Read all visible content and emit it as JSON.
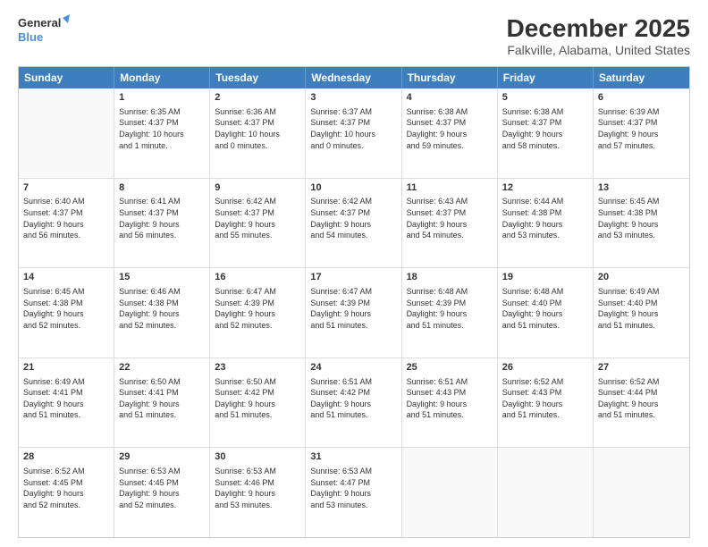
{
  "header": {
    "logo_line1": "General",
    "logo_line2": "Blue",
    "main_title": "December 2025",
    "subtitle": "Falkville, Alabama, United States"
  },
  "days_of_week": [
    "Sunday",
    "Monday",
    "Tuesday",
    "Wednesday",
    "Thursday",
    "Friday",
    "Saturday"
  ],
  "weeks": [
    [
      {
        "day": "",
        "info": ""
      },
      {
        "day": "1",
        "info": "Sunrise: 6:35 AM\nSunset: 4:37 PM\nDaylight: 10 hours\nand 1 minute."
      },
      {
        "day": "2",
        "info": "Sunrise: 6:36 AM\nSunset: 4:37 PM\nDaylight: 10 hours\nand 0 minutes."
      },
      {
        "day": "3",
        "info": "Sunrise: 6:37 AM\nSunset: 4:37 PM\nDaylight: 10 hours\nand 0 minutes."
      },
      {
        "day": "4",
        "info": "Sunrise: 6:38 AM\nSunset: 4:37 PM\nDaylight: 9 hours\nand 59 minutes."
      },
      {
        "day": "5",
        "info": "Sunrise: 6:38 AM\nSunset: 4:37 PM\nDaylight: 9 hours\nand 58 minutes."
      },
      {
        "day": "6",
        "info": "Sunrise: 6:39 AM\nSunset: 4:37 PM\nDaylight: 9 hours\nand 57 minutes."
      }
    ],
    [
      {
        "day": "7",
        "info": "Sunrise: 6:40 AM\nSunset: 4:37 PM\nDaylight: 9 hours\nand 56 minutes."
      },
      {
        "day": "8",
        "info": "Sunrise: 6:41 AM\nSunset: 4:37 PM\nDaylight: 9 hours\nand 56 minutes."
      },
      {
        "day": "9",
        "info": "Sunrise: 6:42 AM\nSunset: 4:37 PM\nDaylight: 9 hours\nand 55 minutes."
      },
      {
        "day": "10",
        "info": "Sunrise: 6:42 AM\nSunset: 4:37 PM\nDaylight: 9 hours\nand 54 minutes."
      },
      {
        "day": "11",
        "info": "Sunrise: 6:43 AM\nSunset: 4:37 PM\nDaylight: 9 hours\nand 54 minutes."
      },
      {
        "day": "12",
        "info": "Sunrise: 6:44 AM\nSunset: 4:38 PM\nDaylight: 9 hours\nand 53 minutes."
      },
      {
        "day": "13",
        "info": "Sunrise: 6:45 AM\nSunset: 4:38 PM\nDaylight: 9 hours\nand 53 minutes."
      }
    ],
    [
      {
        "day": "14",
        "info": "Sunrise: 6:45 AM\nSunset: 4:38 PM\nDaylight: 9 hours\nand 52 minutes."
      },
      {
        "day": "15",
        "info": "Sunrise: 6:46 AM\nSunset: 4:38 PM\nDaylight: 9 hours\nand 52 minutes."
      },
      {
        "day": "16",
        "info": "Sunrise: 6:47 AM\nSunset: 4:39 PM\nDaylight: 9 hours\nand 52 minutes."
      },
      {
        "day": "17",
        "info": "Sunrise: 6:47 AM\nSunset: 4:39 PM\nDaylight: 9 hours\nand 51 minutes."
      },
      {
        "day": "18",
        "info": "Sunrise: 6:48 AM\nSunset: 4:39 PM\nDaylight: 9 hours\nand 51 minutes."
      },
      {
        "day": "19",
        "info": "Sunrise: 6:48 AM\nSunset: 4:40 PM\nDaylight: 9 hours\nand 51 minutes."
      },
      {
        "day": "20",
        "info": "Sunrise: 6:49 AM\nSunset: 4:40 PM\nDaylight: 9 hours\nand 51 minutes."
      }
    ],
    [
      {
        "day": "21",
        "info": "Sunrise: 6:49 AM\nSunset: 4:41 PM\nDaylight: 9 hours\nand 51 minutes."
      },
      {
        "day": "22",
        "info": "Sunrise: 6:50 AM\nSunset: 4:41 PM\nDaylight: 9 hours\nand 51 minutes."
      },
      {
        "day": "23",
        "info": "Sunrise: 6:50 AM\nSunset: 4:42 PM\nDaylight: 9 hours\nand 51 minutes."
      },
      {
        "day": "24",
        "info": "Sunrise: 6:51 AM\nSunset: 4:42 PM\nDaylight: 9 hours\nand 51 minutes."
      },
      {
        "day": "25",
        "info": "Sunrise: 6:51 AM\nSunset: 4:43 PM\nDaylight: 9 hours\nand 51 minutes."
      },
      {
        "day": "26",
        "info": "Sunrise: 6:52 AM\nSunset: 4:43 PM\nDaylight: 9 hours\nand 51 minutes."
      },
      {
        "day": "27",
        "info": "Sunrise: 6:52 AM\nSunset: 4:44 PM\nDaylight: 9 hours\nand 51 minutes."
      }
    ],
    [
      {
        "day": "28",
        "info": "Sunrise: 6:52 AM\nSunset: 4:45 PM\nDaylight: 9 hours\nand 52 minutes."
      },
      {
        "day": "29",
        "info": "Sunrise: 6:53 AM\nSunset: 4:45 PM\nDaylight: 9 hours\nand 52 minutes."
      },
      {
        "day": "30",
        "info": "Sunrise: 6:53 AM\nSunset: 4:46 PM\nDaylight: 9 hours\nand 53 minutes."
      },
      {
        "day": "31",
        "info": "Sunrise: 6:53 AM\nSunset: 4:47 PM\nDaylight: 9 hours\nand 53 minutes."
      },
      {
        "day": "",
        "info": ""
      },
      {
        "day": "",
        "info": ""
      },
      {
        "day": "",
        "info": ""
      }
    ]
  ]
}
